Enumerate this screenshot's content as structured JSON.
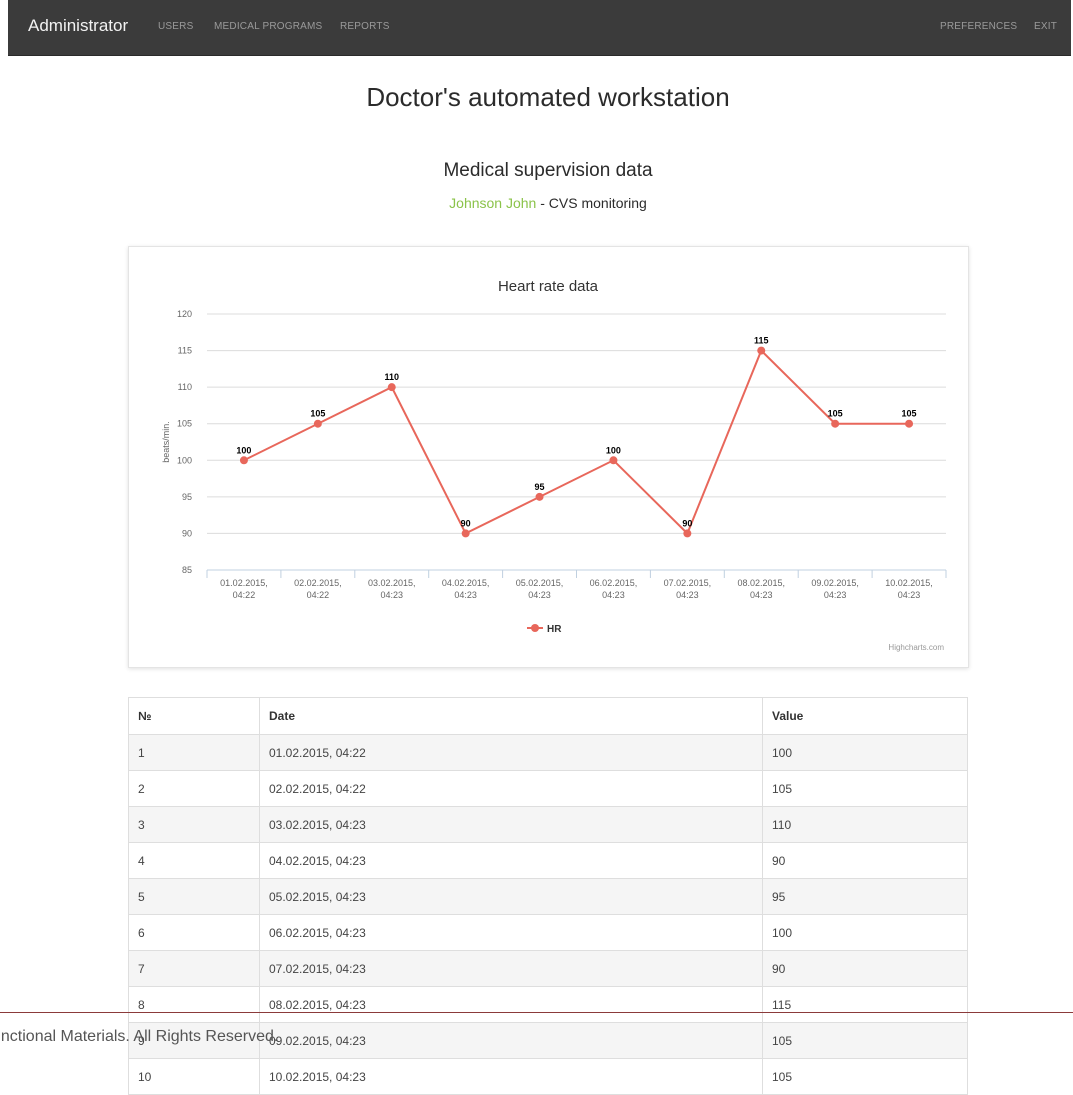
{
  "navbar": {
    "brand": "Administrator",
    "links": [
      "USERS",
      "MEDICAL PROGRAMS",
      "REPORTS"
    ],
    "right_links": [
      "PREFERENCES",
      "EXIT"
    ]
  },
  "page": {
    "title": "Doctor's automated workstation",
    "subtitle": "Medical supervision data",
    "patient_name": "Johnson John",
    "program": " - CVS monitoring"
  },
  "chart_data": {
    "type": "line",
    "title": "Heart rate data",
    "ylabel": "beats/min.",
    "ylim": [
      85,
      120
    ],
    "y_ticks": [
      85,
      90,
      95,
      100,
      105,
      110,
      115,
      120
    ],
    "categories": [
      [
        "01.02.2015,",
        "04:22"
      ],
      [
        "02.02.2015,",
        "04:22"
      ],
      [
        "03.02.2015,",
        "04:23"
      ],
      [
        "04.02.2015,",
        "04:23"
      ],
      [
        "05.02.2015,",
        "04:23"
      ],
      [
        "06.02.2015,",
        "04:23"
      ],
      [
        "07.02.2015,",
        "04:23"
      ],
      [
        "08.02.2015,",
        "04:23"
      ],
      [
        "09.02.2015,",
        "04:23"
      ],
      [
        "10.02.2015,",
        "04:23"
      ]
    ],
    "series": [
      {
        "name": "HR",
        "values": [
          100,
          105,
          110,
          90,
          95,
          100,
          90,
          115,
          105,
          105
        ],
        "color": "#e8675b"
      }
    ],
    "legend_position": "bottom",
    "credit": "Highcharts.com",
    "grid": true
  },
  "table": {
    "headers": [
      "№",
      "Date",
      "Value"
    ],
    "rows": [
      [
        "1",
        "01.02.2015, 04:22",
        "100"
      ],
      [
        "2",
        "02.02.2015, 04:22",
        "105"
      ],
      [
        "3",
        "03.02.2015, 04:23",
        "110"
      ],
      [
        "4",
        "04.02.2015, 04:23",
        "90"
      ],
      [
        "5",
        "05.02.2015, 04:23",
        "95"
      ],
      [
        "6",
        "06.02.2015, 04:23",
        "100"
      ],
      [
        "7",
        "07.02.2015, 04:23",
        "90"
      ],
      [
        "8",
        "08.02.2015, 04:23",
        "115"
      ],
      [
        "9",
        "09.02.2015, 04:23",
        "105"
      ],
      [
        "10",
        "10.02.2015, 04:23",
        "105"
      ]
    ]
  },
  "footer": {
    "text": "unctional Materials. All Rights Reserved."
  }
}
